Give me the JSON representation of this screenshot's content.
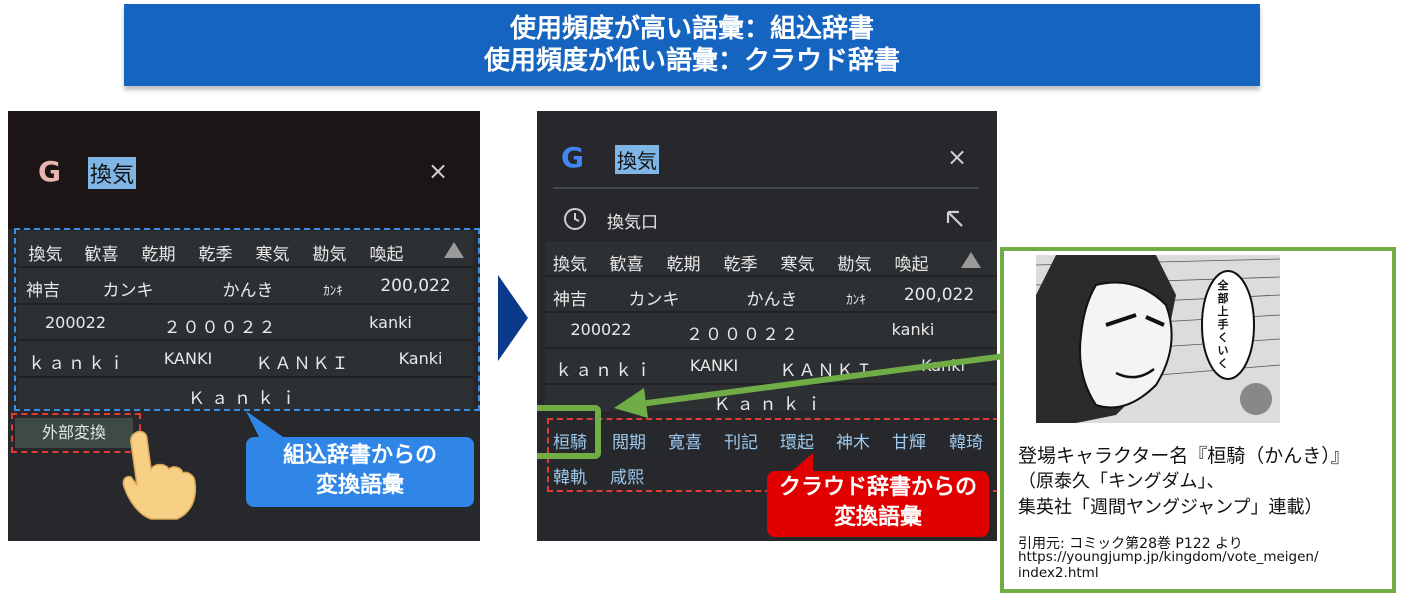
{
  "banner": {
    "line1": "使用頻度が高い語彙：組込辞書",
    "line2": "使用頻度が低い語彙：クラウド辞書"
  },
  "left_phone": {
    "logo": "G",
    "query": "換気",
    "close": "×",
    "rows": [
      [
        "換気",
        "歓喜",
        "乾期",
        "乾季",
        "寒気",
        "勘気",
        "喚起"
      ],
      [
        "神吉",
        "カンキ",
        "かんき",
        "ｶﾝｷ",
        "200,022"
      ],
      [
        "200022",
        "２０００２２",
        "kanki"
      ],
      [
        "ｋａｎｋｉ",
        "KANKI",
        "ＫＡＮＫＩ",
        "Kanki"
      ],
      [
        "Ｋａｎｋｉ"
      ]
    ],
    "external_button": "外部変換",
    "callout": [
      "組込辞書からの",
      "変換語彙"
    ]
  },
  "right_phone": {
    "logo": "G",
    "query": "換気",
    "close": "×",
    "history_item": "換気口",
    "rows": [
      [
        "換気",
        "歓喜",
        "乾期",
        "乾季",
        "寒気",
        "勘気",
        "喚起"
      ],
      [
        "神吉",
        "カンキ",
        "かんき",
        "ｶﾝｷ",
        "200,022"
      ],
      [
        "200022",
        "２０００２２",
        "kanki"
      ],
      [
        "ｋａｎｋｉ",
        "KANKI",
        "ＫＡＮＫＩ",
        "Kanki"
      ],
      [
        "Ｋａｎｋｉ"
      ]
    ],
    "cloud_row1": [
      "桓騎",
      "閲期",
      "寛喜",
      "刊記",
      "環起",
      "神木",
      "甘輝",
      "韓琦"
    ],
    "cloud_row2": [
      "韓軌",
      "咸熙"
    ],
    "callout": [
      "クラウド辞書からの",
      "変換語彙"
    ]
  },
  "card": {
    "manga_text": "全部上手くいく",
    "caption_line1": "登場キャラクター名『桓騎（かんき）』",
    "caption_line2": "（原泰久「キングダム」、",
    "caption_line3": "集英社「週間ヤングジャンプ」連載）",
    "source_line1": "引用元: コミック第28巻 P122 より",
    "source_line2": "https://youngjump.jp/kingdom/vote_meigen/",
    "source_line3": "index2.html"
  },
  "colors": {
    "banner": "#1565c0",
    "blue_callout": "#2f86e6",
    "red_callout": "#e00000",
    "card_border": "#70ad47",
    "arrow": "#0b3a8a"
  }
}
